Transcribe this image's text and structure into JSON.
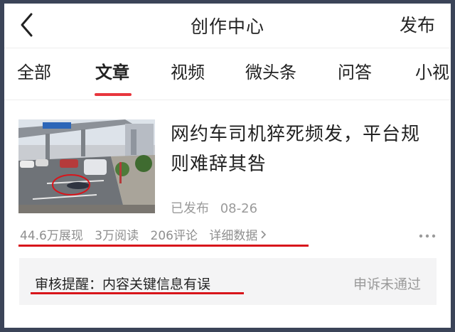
{
  "header": {
    "back_icon": "chevron-left-icon",
    "title": "创作中心",
    "publish_label": "发布"
  },
  "tabs": [
    {
      "label": "全部",
      "active": false
    },
    {
      "label": "文章",
      "active": true
    },
    {
      "label": "视频",
      "active": false
    },
    {
      "label": "微头条",
      "active": false
    },
    {
      "label": "问答",
      "active": false
    },
    {
      "label": "小视",
      "active": false
    }
  ],
  "article": {
    "thumbnail_icon": "street-photo-thumbnail",
    "title": "网约车司机猝死频发，平台规则难辞其咎",
    "status": "已发布",
    "date": "08-26",
    "stats": {
      "impressions": "44.6万展现",
      "reads": "3万阅读",
      "comments": "206评论",
      "detail_label": "详细数据",
      "detail_icon": "chevron-right-icon"
    },
    "more_icon": "more-dots-icon"
  },
  "notice": {
    "text": "审核提醒：内容关键信息有误",
    "appeal_status": "申诉未通过"
  },
  "colors": {
    "accent_red": "#e8363d",
    "annotation_red": "#d8151b",
    "muted_text": "#9a9a9a"
  }
}
